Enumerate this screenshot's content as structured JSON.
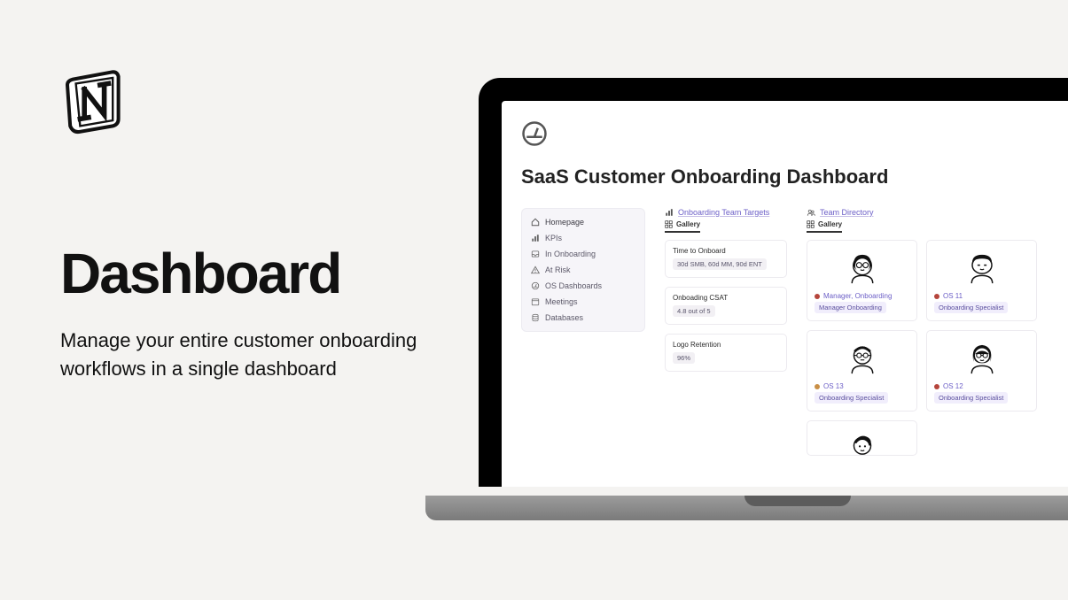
{
  "hero": {
    "title": "Dashboard",
    "subtitle": "Manage your entire customer onboarding workflows in a single dashboard"
  },
  "app": {
    "pageTitle": "SaaS Customer Onboarding Dashboard"
  },
  "nav": {
    "items": [
      {
        "icon": "home-icon",
        "label": "Homepage"
      },
      {
        "icon": "bar-chart-icon",
        "label": "KPIs"
      },
      {
        "icon": "inbox-icon",
        "label": "In Onboarding"
      },
      {
        "icon": "warning-icon",
        "label": "At Risk"
      },
      {
        "icon": "gauge-icon",
        "label": "OS Dashboards"
      },
      {
        "icon": "calendar-icon",
        "label": "Meetings"
      },
      {
        "icon": "database-icon",
        "label": "Databases"
      }
    ]
  },
  "targets": {
    "header": "Onboarding Team Targets",
    "viewTab": "Gallery",
    "cards": [
      {
        "title": "Time to Onboard",
        "badge": "30d SMB, 60d MM, 90d ENT"
      },
      {
        "title": "Onboading CSAT",
        "badge": "4.8 out of 5"
      },
      {
        "title": "Logo Retention",
        "badge": "96%"
      }
    ]
  },
  "directory": {
    "header": "Team Directory",
    "viewTab": "Gallery",
    "people": [
      {
        "name": "Manager, Onboarding",
        "role": "Manager Onboarding",
        "dot": "r"
      },
      {
        "name": "OS 11",
        "role": "Onboarding Specialist",
        "dot": "r"
      },
      {
        "name": "OS 13",
        "role": "Onboarding Specialist",
        "dot": "o"
      },
      {
        "name": "OS 12",
        "role": "Onboarding Specialist",
        "dot": "r"
      }
    ]
  }
}
